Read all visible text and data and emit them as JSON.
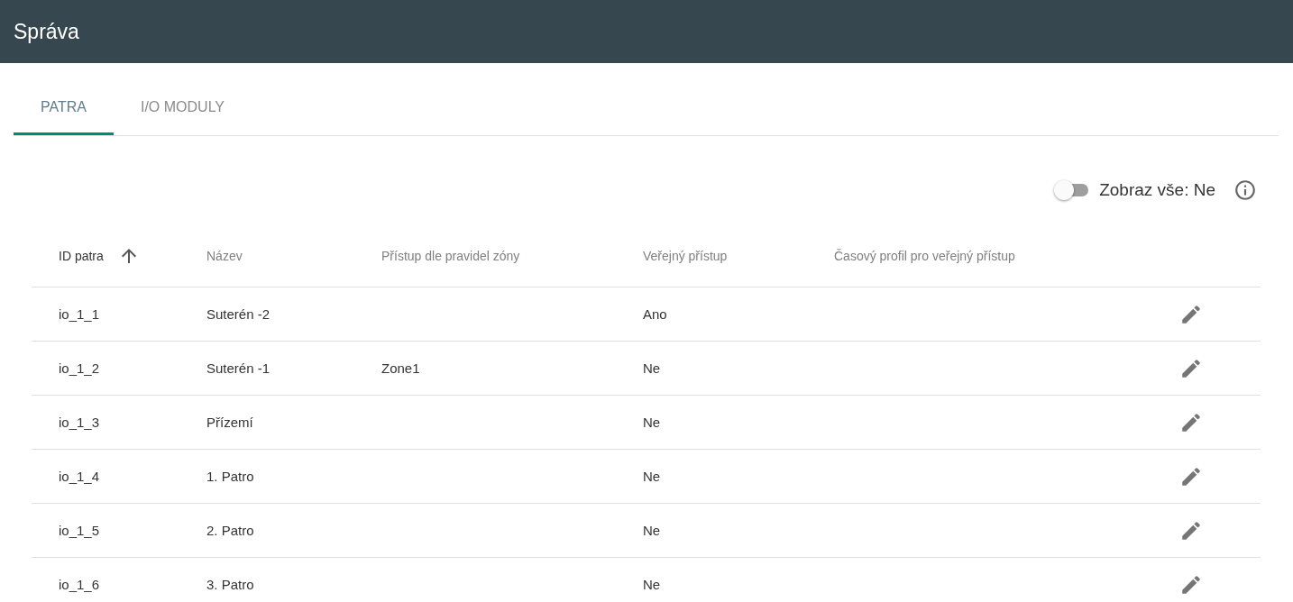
{
  "app_bar": {
    "title": "Správa"
  },
  "tabs": [
    {
      "label": "PATRA",
      "selected": true
    },
    {
      "label": "I/O MODULY",
      "selected": false
    }
  ],
  "show_all": {
    "label": "Zobraz vše: Ne",
    "on": false
  },
  "table": {
    "columns": [
      {
        "label": "ID patra",
        "sorted": true
      },
      {
        "label": "Název",
        "sorted": false
      },
      {
        "label": "Přístup dle pravidel zóny",
        "sorted": false
      },
      {
        "label": "Veřejný přístup",
        "sorted": false
      },
      {
        "label": "Časový profil pro veřejný přístup",
        "sorted": false
      }
    ],
    "rows": [
      {
        "cells": [
          "io_1_1",
          "Suterén -2",
          "",
          "Ano",
          ""
        ]
      },
      {
        "cells": [
          "io_1_2",
          "Suterén -1",
          "Zone1",
          "Ne",
          ""
        ]
      },
      {
        "cells": [
          "io_1_3",
          "Přízemí",
          "",
          "Ne",
          ""
        ]
      },
      {
        "cells": [
          "io_1_4",
          "1. Patro",
          "",
          "Ne",
          ""
        ]
      },
      {
        "cells": [
          "io_1_5",
          "2. Patro",
          "",
          "Ne",
          ""
        ]
      },
      {
        "cells": [
          "io_1_6",
          "3. Patro",
          "",
          "Ne",
          ""
        ]
      }
    ]
  }
}
